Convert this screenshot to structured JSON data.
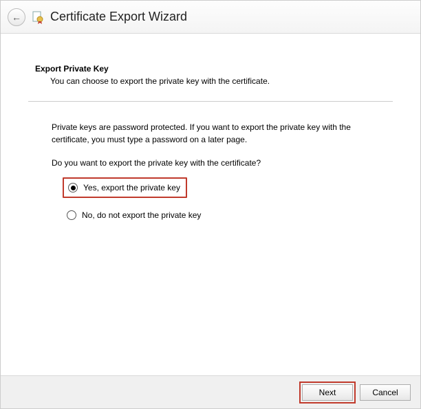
{
  "titlebar": {
    "title": "Certificate Export Wizard"
  },
  "page": {
    "heading": "Export Private Key",
    "subheading": "You can choose to export the private key with the certificate.",
    "info": "Private keys are password protected. If you want to export the private key with the certificate, you must type a password on a later page.",
    "question": "Do you want to export the private key with the certificate?",
    "options": {
      "yes": "Yes, export the private key",
      "no": "No, do not export the private key"
    }
  },
  "footer": {
    "next": "Next",
    "cancel": "Cancel"
  }
}
